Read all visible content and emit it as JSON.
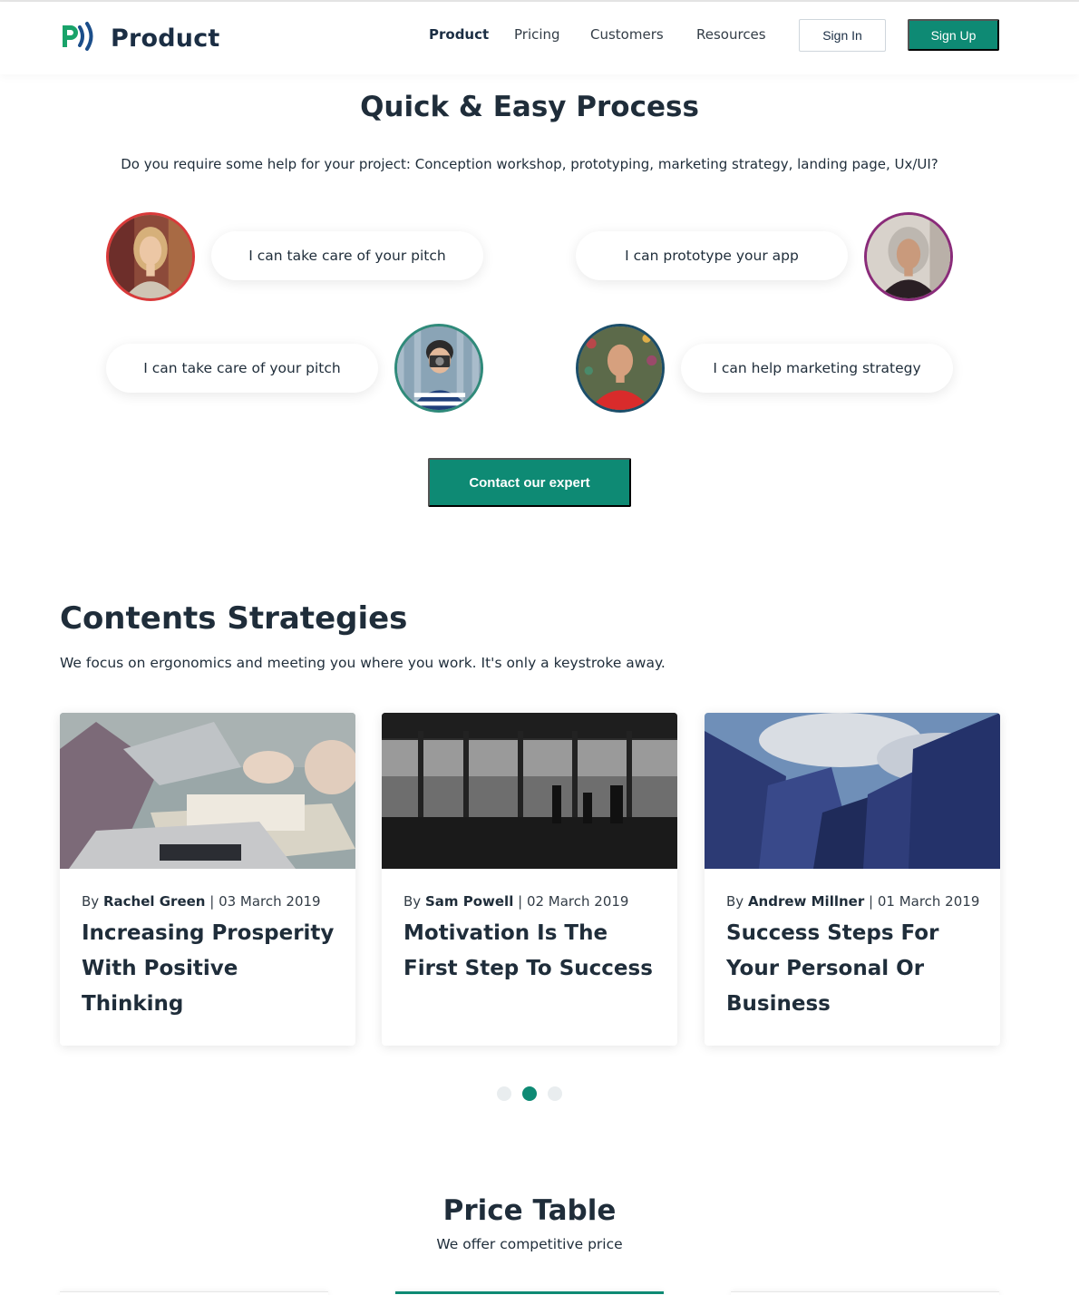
{
  "brand": {
    "name": "Product",
    "icon": "product-logo-icon",
    "accent": "#0e8a74"
  },
  "nav": {
    "items": [
      {
        "label": "Product",
        "active": true
      },
      {
        "label": "Pricing",
        "active": false
      },
      {
        "label": "Customers",
        "active": false
      },
      {
        "label": "Resources",
        "active": false
      }
    ],
    "signin_label": "Sign In",
    "signup_label": "Sign Up"
  },
  "process": {
    "title": "Quick & Easy Process",
    "subtitle": "Do you require some help for your project: Conception workshop, prototyping, marketing strategy, landing page, Ux/UI?",
    "experts": [
      {
        "text": "I can take care of your pitch",
        "avatar": "woman-blonde-avatar"
      },
      {
        "text": "I can prototype your app",
        "avatar": "woman-gray-hair-avatar"
      },
      {
        "text": "I can take care of your pitch",
        "avatar": "man-camera-avatar"
      },
      {
        "text": "I can help marketing strategy",
        "avatar": "man-red-shirt-avatar"
      }
    ],
    "cta_label": "Contact our expert"
  },
  "strategies": {
    "title": "Contents Strategies",
    "subtitle": "We focus on ergonomics and meeting you where you work. It's only a keystroke away.",
    "cards": [
      {
        "by": "By",
        "author": "Rachel Green",
        "date": "| 03 March 2019",
        "title": "Increasing Prosperity With Positive Thinking",
        "image": "laptop-desk-photo"
      },
      {
        "by": "By",
        "author": "Sam Powell",
        "date": "| 02 March 2019",
        "title": "Motivation Is The First Step To Success",
        "image": "office-window-silhouettes-photo"
      },
      {
        "by": "By",
        "author": "Andrew Millner",
        "date": "| 01 March 2019",
        "title": "Success Steps For Your Personal Or Business",
        "image": "skyscrapers-photo"
      }
    ],
    "carousel_active_index": 1,
    "carousel_count": 3
  },
  "price": {
    "title": "Price Table",
    "subtitle": "We offer competitive price"
  }
}
